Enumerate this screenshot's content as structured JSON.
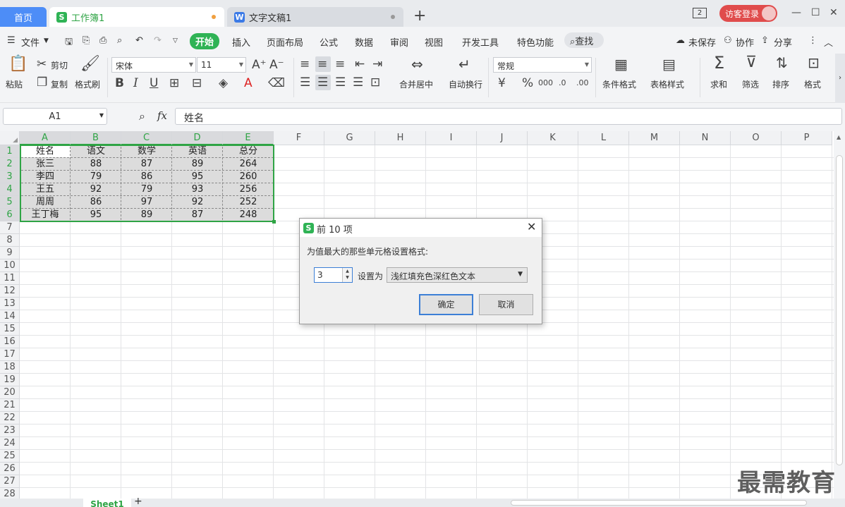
{
  "tabs": {
    "home": "首页",
    "workbook": "工作簿1",
    "document": "文字文稿1",
    "new_tab": "+"
  },
  "titlebar": {
    "counter": "2",
    "login": "访客登录"
  },
  "menu": [
    "文件",
    "开始",
    "插入",
    "页面布局",
    "公式",
    "数据",
    "审阅",
    "视图",
    "开发工具",
    "特色功能"
  ],
  "search_label": "查找",
  "menu_right": {
    "unsaved": "未保存",
    "collab": "协作",
    "share": "分享"
  },
  "ribbon": {
    "paste": "粘贴",
    "cut": "剪切",
    "copy": "复制",
    "format_painter": "格式刷",
    "font_name": "宋体",
    "font_size": "11",
    "merge_center": "合并居中",
    "wrap_text": "自动换行",
    "number_format": "常规",
    "cond_format": "条件格式",
    "table_style": "表格样式",
    "sum": "求和",
    "filter": "筛选",
    "sort": "排序",
    "format": "格式"
  },
  "formula_bar": {
    "cell_ref": "A1",
    "fx": "fx",
    "content": "姓名"
  },
  "columns": [
    "A",
    "B",
    "C",
    "D",
    "E",
    "F",
    "G",
    "H",
    "I",
    "J",
    "K",
    "L",
    "M",
    "N",
    "O",
    "P"
  ],
  "rows": [
    "1",
    "2",
    "3",
    "4",
    "5",
    "6",
    "7",
    "8",
    "9",
    "10",
    "11",
    "12",
    "13",
    "14",
    "15",
    "16",
    "17",
    "18",
    "19",
    "20",
    "21",
    "22",
    "23",
    "24",
    "25",
    "26",
    "27",
    "28"
  ],
  "table": [
    [
      "姓名",
      "语文",
      "数学",
      "英语",
      "总分"
    ],
    [
      "张三",
      "88",
      "87",
      "89",
      "264"
    ],
    [
      "李四",
      "79",
      "86",
      "95",
      "260"
    ],
    [
      "王五",
      "92",
      "79",
      "93",
      "256"
    ],
    [
      "周周",
      "86",
      "97",
      "92",
      "252"
    ],
    [
      "王丁梅",
      "95",
      "89",
      "87",
      "248"
    ]
  ],
  "sheet_tab": "Sheet1",
  "dialog": {
    "title": "前 10 项",
    "prompt": "为值最大的那些单元格设置格式:",
    "count": "3",
    "set_as": "设置为",
    "format_option": "浅红填充色深红色文本",
    "ok": "确定",
    "cancel": "取消"
  },
  "watermark": "最需教育",
  "colors": {
    "accent_green": "#2fa445",
    "tab_blue": "#4d8df7",
    "login_red": "#e04c4c"
  }
}
